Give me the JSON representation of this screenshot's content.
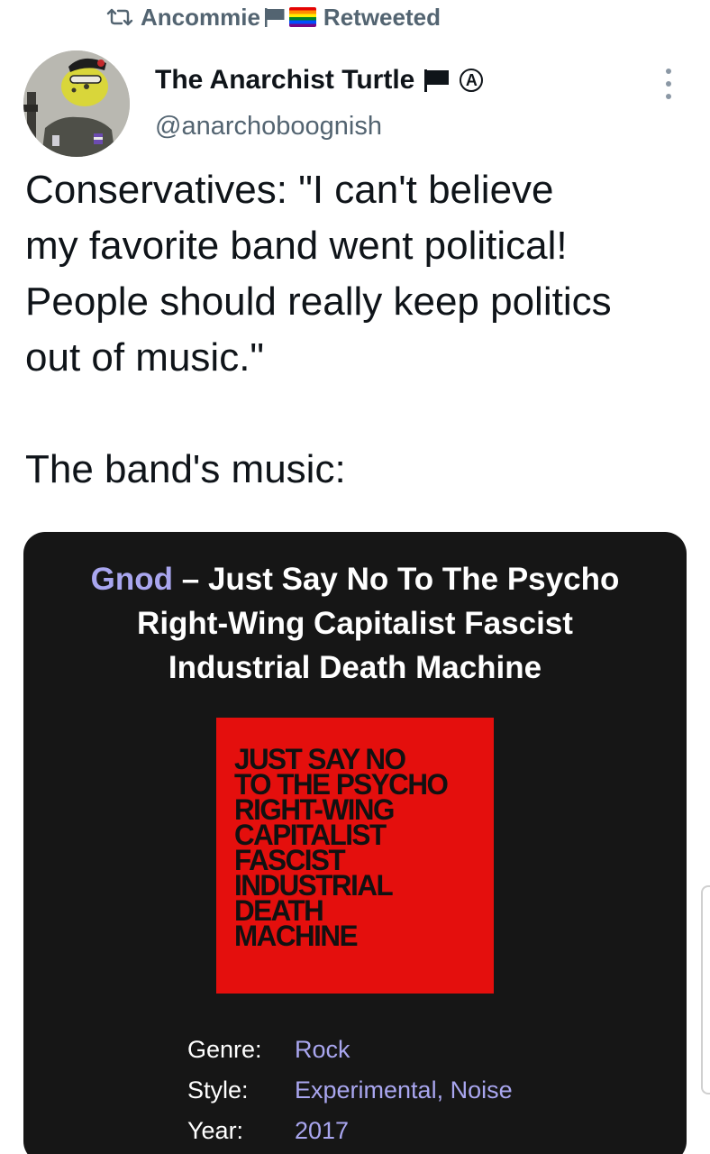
{
  "retweet": {
    "icon": "retweet-icon",
    "user": "Ancommie",
    "flags": [
      "black-flag-icon",
      "rainbow-flag-icon"
    ],
    "label": "Retweeted"
  },
  "author": {
    "avatar": "avatar",
    "name": "The Anarchist Turtle",
    "name_icons": [
      "black-flag-icon",
      "circle-a-icon"
    ],
    "circle_a": "Ⓐ",
    "handle": "@anarchoboognish"
  },
  "more_menu": "more-options-icon",
  "tweet": {
    "lines": [
      "Conservatives: \"I can't believe",
      "my favorite band went political!",
      "People should really keep politics",
      "out of music.\""
    ],
    "second_paragraph": "The band's music:"
  },
  "card": {
    "artist": "Gnod",
    "dash": " – ",
    "title_line1": "Just Say No To The Psycho",
    "title_line2": "Right-Wing Capitalist Fascist",
    "title_line3": "Industrial Death Machine",
    "cover_lines": [
      "JUST SAY NO",
      "TO THE PSYCHO",
      "RIGHT-WING",
      "CAPITALIST",
      "FASCIST",
      "INDUSTRIAL",
      "DEATH",
      "MACHINE"
    ],
    "cover_color": "#e40f0d",
    "accent_color": "#a9a6ef",
    "meta": {
      "genre_label": "Genre:",
      "genre_value": "Rock",
      "style_label": "Style:",
      "style_value": "Experimental, Noise",
      "year_label": "Year:",
      "year_value": "2017"
    }
  }
}
